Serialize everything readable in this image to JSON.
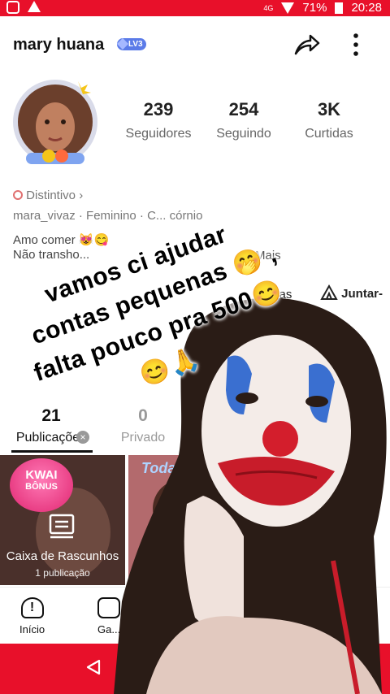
{
  "status_bar": {
    "network": "4G",
    "battery": "71%",
    "time": "20:28",
    "color": "#e8102a"
  },
  "profile": {
    "username": "mary huana",
    "level_badge": "LV3",
    "badge_label": "Distintivo",
    "handle": "mara_vivaz",
    "gender": "Feminino",
    "extra": "C... córnio",
    "bio_line1": "Amo comer 😻😋",
    "bio_line2": "Não transho...",
    "more": "Mais"
  },
  "stats": [
    {
      "value": "239",
      "label": "Seguidores"
    },
    {
      "value": "254",
      "label": "Seguindo"
    },
    {
      "value": "3K",
      "label": "Curtidas"
    }
  ],
  "actions": {
    "partial_left": "...ras",
    "join": "Juntar-"
  },
  "overlay_text": {
    "line1": "vamos ci ajudar",
    "line2": "contas pequenas 🤭 ,",
    "line3": "falta pouco pra 500😊",
    "line4": "😊🙏"
  },
  "tabs": [
    {
      "count": "21",
      "label": "Publicações"
    },
    {
      "count": "0",
      "label": "Privado"
    }
  ],
  "grid": {
    "promo_line1": "KWAI",
    "promo_line2": "BÔNUS",
    "drafts_label": "Caixa de Rascunhos",
    "drafts_count": "1 publicação",
    "today_label": "Today"
  },
  "bottom_nav": [
    {
      "label": "Início",
      "icon": "home-info-icon"
    },
    {
      "label": "Ga...",
      "icon": "gamepad-icon"
    }
  ],
  "icons": {
    "share": "share-arrow-icon",
    "more": "more-vertical-icon",
    "back": "back-triangle-icon",
    "close": "close-circle-icon"
  }
}
